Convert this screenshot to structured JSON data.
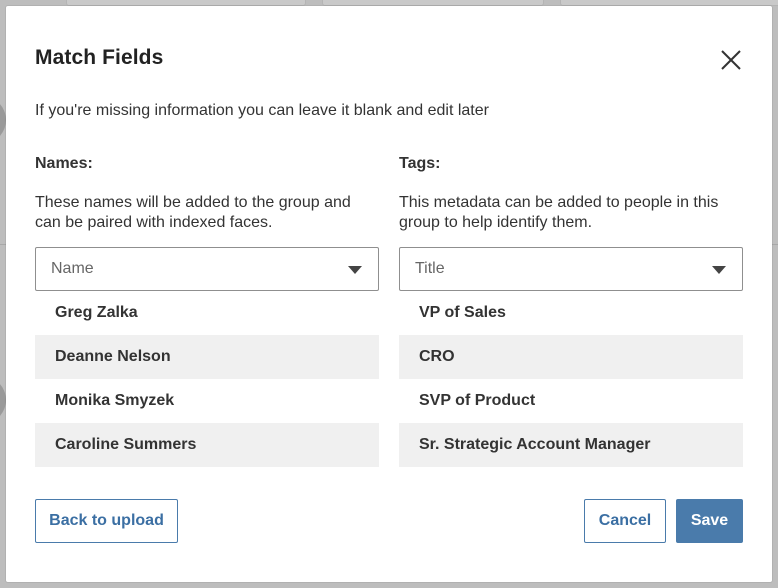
{
  "dialog": {
    "title": "Match Fields",
    "subtitle": "If you're missing information you can leave it blank and edit later"
  },
  "names": {
    "heading": "Names:",
    "description": "These names will be added to the group and can be paired with indexed faces.",
    "select_value": "Name",
    "items": [
      "Greg Zalka",
      "Deanne Nelson",
      "Monika Smyzek",
      "Caroline Summers"
    ]
  },
  "tags": {
    "heading": "Tags:",
    "description": "This metadata can be added to people in this group to help identify them.",
    "select_value": "Title",
    "items": [
      "VP of Sales",
      "CRO",
      "SVP of Product",
      "Sr. Strategic Account Manager"
    ]
  },
  "buttons": {
    "back": "Back to upload",
    "cancel": "Cancel",
    "save": "Save"
  },
  "icons": {
    "close": "close-icon",
    "dropdown": "chevron-down-icon"
  },
  "colors": {
    "accent": "#4a7bab",
    "row_alt": "#f0f0f0"
  }
}
